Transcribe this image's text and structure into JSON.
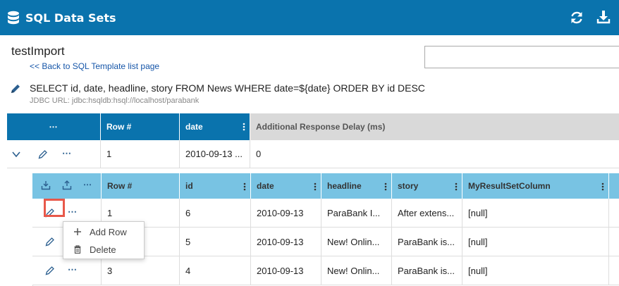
{
  "header": {
    "title": "SQL Data Sets",
    "icons": [
      "database-icon",
      "refresh-icon",
      "download-icon"
    ],
    "bg_color": "#0a73ad"
  },
  "dataset": {
    "name": "testImport",
    "back_link": "<< Back to SQL Template list page",
    "search_value": "",
    "sql": "SELECT id, date, headline, story FROM News WHERE date=${date} ORDER BY id DESC",
    "jdbc": "JDBC URL: jdbc:hsqldb:hsql://localhost/parabank"
  },
  "outer_table": {
    "headers": {
      "actions": "⋯",
      "row_num": "Row #",
      "date": "date",
      "delay": "Additional Response Delay (ms)"
    },
    "row": {
      "actions": "⋯",
      "row_num": "1",
      "date": "2010-09-13 ...",
      "delay": "0"
    }
  },
  "inner_table": {
    "headers": {
      "actions": "⋯",
      "row_num": "Row #",
      "id": "id",
      "date": "date",
      "headline": "headline",
      "story": "story",
      "col": "MyResultSetColumn"
    },
    "rows": [
      {
        "actions": "⋯",
        "row_num": "1",
        "id": "6",
        "date": "2010-09-13",
        "headline": "ParaBank I...",
        "story": "After extens...",
        "col": "[null]"
      },
      {
        "actions": "⋯",
        "row_num": "",
        "id": "5",
        "date": "2010-09-13",
        "headline": "New! Onlin...",
        "story": "ParaBank is...",
        "col": "[null]"
      },
      {
        "actions": "⋯",
        "row_num": "3",
        "id": "4",
        "date": "2010-09-13",
        "headline": "New! Onlin...",
        "story": "ParaBank is...",
        "col": "[null]"
      }
    ]
  },
  "context_menu": {
    "items": [
      {
        "label": "Add Row",
        "icon": "plus-icon"
      },
      {
        "label": "Delete",
        "icon": "trash-icon"
      }
    ]
  },
  "colors": {
    "primary": "#0a73ad",
    "inner_header": "#78c3e3",
    "focus": "#e8584a",
    "link": "#1555a8"
  }
}
